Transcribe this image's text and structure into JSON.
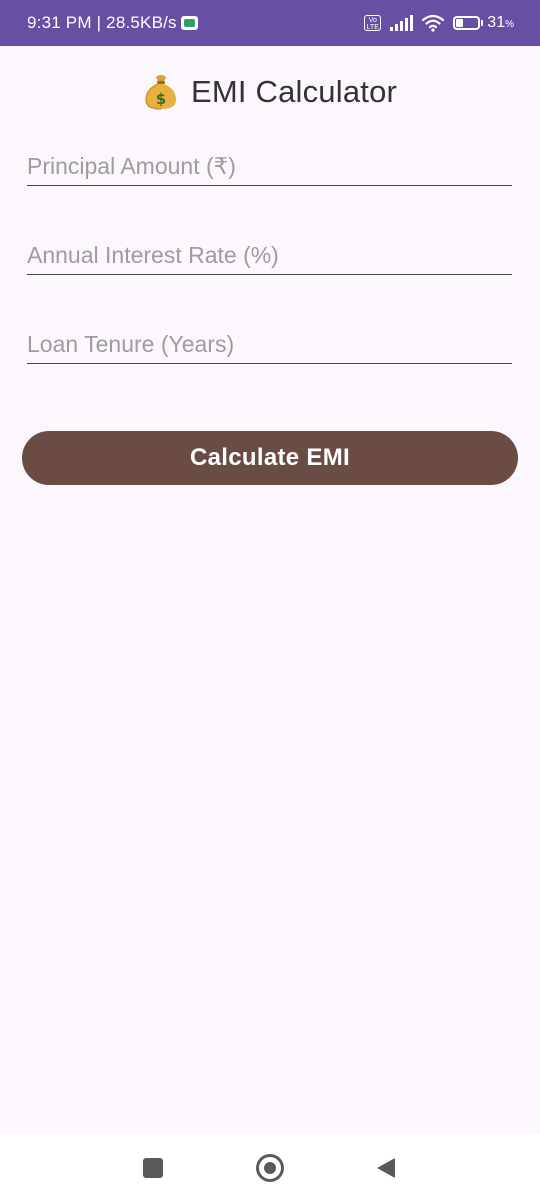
{
  "status_bar": {
    "time_speed": "9:31 PM | 28.5KB/s",
    "volte_label": "Vo LTE",
    "battery_percent": "31",
    "battery_unit": "%",
    "battery_level": 0.31,
    "icons": [
      "notification-app-icon",
      "volte-icon",
      "signal-icon",
      "wifi-icon",
      "battery-icon"
    ]
  },
  "app": {
    "title_emoji_icon": "money-bag-icon",
    "title": "EMI Calculator"
  },
  "form": {
    "principal": {
      "value": "",
      "placeholder": "Principal Amount (₹)"
    },
    "rate": {
      "value": "",
      "placeholder": "Annual Interest Rate (%)"
    },
    "tenure": {
      "value": "",
      "placeholder": "Loan Tenure (Years)"
    },
    "calculate_label": "Calculate EMI"
  },
  "nav_bar": {
    "icons": [
      "recents-icon",
      "home-icon",
      "back-icon"
    ]
  },
  "colors": {
    "status_bar_bg": "#6750A4",
    "page_bg": "#FCF6FD",
    "button_bg": "#6A4C44",
    "button_text": "#FFFFFF",
    "placeholder_text": "#A09AA3",
    "title_text": "#333333",
    "nav_bar_bg": "#FFFFFF",
    "nav_icon": "#5A5A5A"
  }
}
